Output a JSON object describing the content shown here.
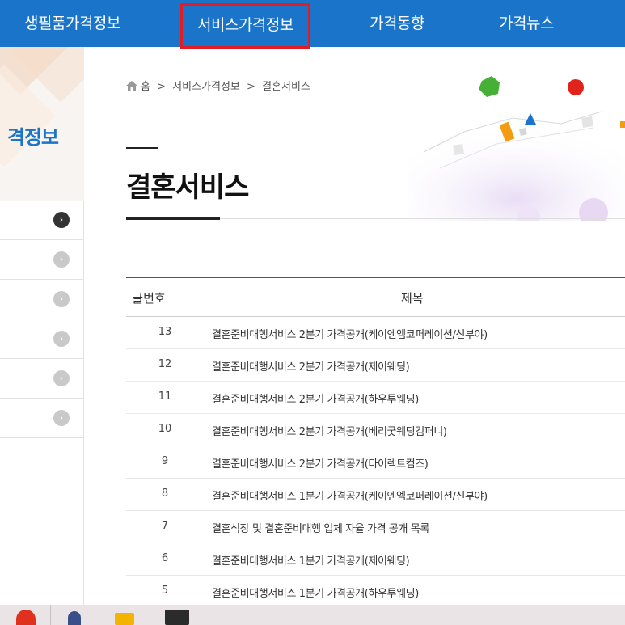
{
  "nav": {
    "items": [
      {
        "label": "생필품가격정보",
        "active": false
      },
      {
        "label": "서비스가격정보",
        "active": true
      },
      {
        "label": "가격동향",
        "active": false
      },
      {
        "label": "가격뉴스",
        "active": false
      }
    ],
    "highlight_color": "#e31b23",
    "bar_color": "#1a74c9"
  },
  "sidebar": {
    "title": "격정보",
    "items": [
      {
        "label": "",
        "arrow_icon": "chevron-right-circle-icon",
        "active": true
      },
      {
        "label": "",
        "arrow_icon": "chevron-right-circle-icon",
        "active": false
      },
      {
        "label": "",
        "arrow_icon": "chevron-right-circle-icon",
        "active": false
      },
      {
        "label": "",
        "arrow_icon": "chevron-right-circle-icon",
        "active": false
      },
      {
        "label": "",
        "arrow_icon": "chevron-right-circle-icon",
        "active": false
      },
      {
        "label": "",
        "arrow_icon": "chevron-right-circle-icon",
        "active": false
      }
    ]
  },
  "breadcrumb": {
    "home_icon": "home-icon",
    "items": [
      "홈",
      "서비스가격정보",
      "결혼서비스"
    ],
    "separator": ">"
  },
  "page": {
    "title": "결혼서비스"
  },
  "board": {
    "columns": {
      "number": "글번호",
      "title": "제목"
    },
    "rows": [
      {
        "number": "13",
        "title": "결혼준비대행서비스 2분기 가격공개(케이엔엠코퍼레이션/신부야)"
      },
      {
        "number": "12",
        "title": "결혼준비대행서비스 2분기 가격공개(제이웨딩)"
      },
      {
        "number": "11",
        "title": "결혼준비대행서비스 2분기 가격공개(하우투웨딩)"
      },
      {
        "number": "10",
        "title": "결혼준비대행서비스 2분기 가격공개(베리굿웨딩컴퍼니)"
      },
      {
        "number": "9",
        "title": "결혼준비대행서비스 2분기 가격공개(다이렉트컴즈)"
      },
      {
        "number": "8",
        "title": "결혼준비대행서비스 1분기 가격공개(케이엔엠코퍼레이션/신부야)"
      },
      {
        "number": "7",
        "title": "결혼식장 및 결혼준비대행 업체 자율 가격 공개 목록"
      },
      {
        "number": "6",
        "title": "결혼준비대행서비스 1분기 가격공개(제이웨딩)"
      },
      {
        "number": "5",
        "title": "결혼준비대행서비스 1분기 가격공개(하우투웨딩)"
      }
    ]
  },
  "taskbar": {
    "apps": [
      "chrome-icon",
      "app-icon",
      "folder-icon",
      "terminal-icon"
    ]
  }
}
